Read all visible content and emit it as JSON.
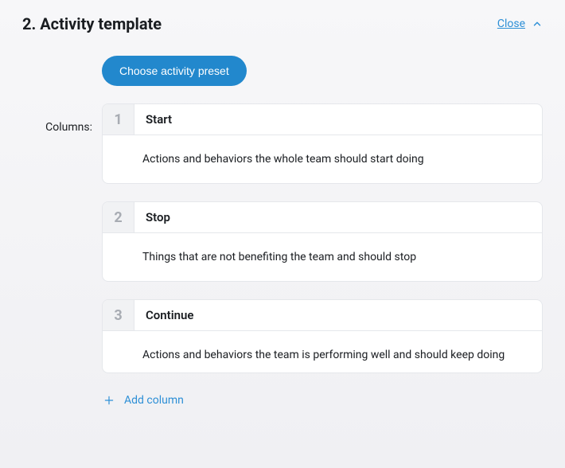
{
  "header": {
    "title": "2. Activity template",
    "close_label": "Close"
  },
  "preset_button": "Choose activity preset",
  "columns_label": "Columns:",
  "columns": [
    {
      "num": "1",
      "title": "Start",
      "description": "Actions and behaviors the whole team should start doing"
    },
    {
      "num": "2",
      "title": "Stop",
      "description": "Things that are not benefiting the team and should stop"
    },
    {
      "num": "3",
      "title": "Continue",
      "description": "Actions and behaviors the team is performing well and should keep doing"
    }
  ],
  "add_column_label": "Add column",
  "colors": {
    "accent": "#2288cd",
    "link": "#2d8fd6"
  }
}
